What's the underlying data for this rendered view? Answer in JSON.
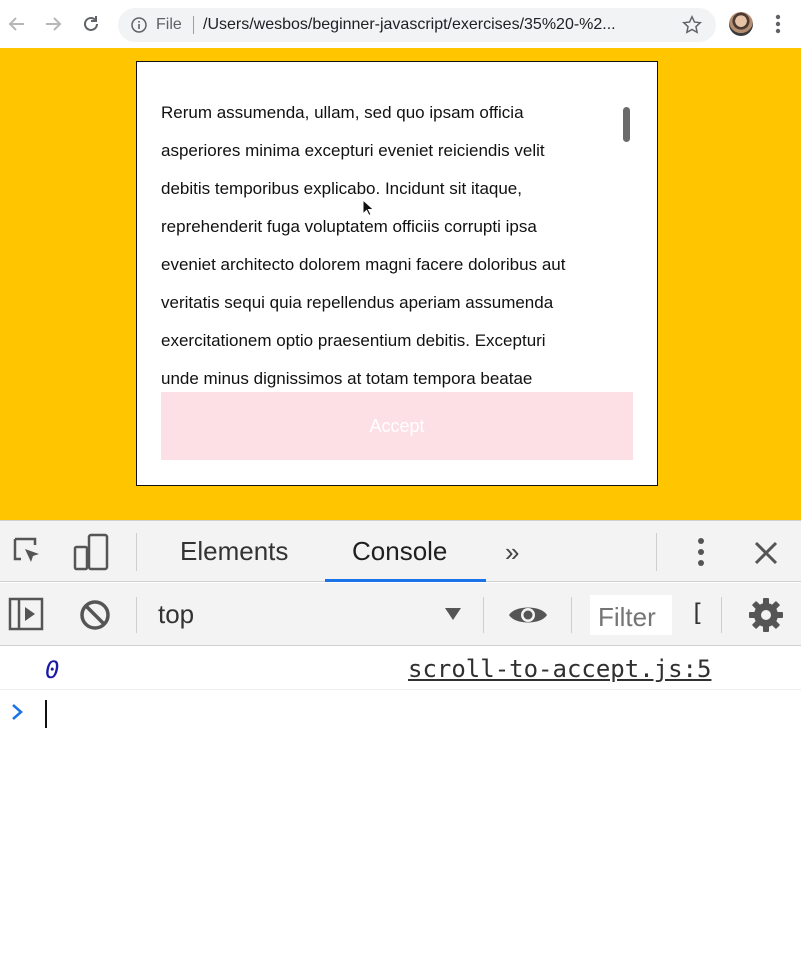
{
  "browser": {
    "omnibox": {
      "scheme_label": "File",
      "url": "/Users/wesbos/beginner-javascript/exercises/35%20-%2..."
    }
  },
  "page": {
    "terms_lines": [
      "Rerum assumenda, ullam, sed quo ipsam officia",
      "asperiores minima excepturi eveniet reiciendis velit",
      "debitis temporibus explicabo. Incidunt sit itaque,",
      "reprehenderit fuga voluptatem officiis corrupti ipsa",
      "eveniet architecto dolorem magni facere doloribus aut",
      "veritatis sequi quia repellendus aperiam assumenda",
      "exercitationem optio praesentium debitis. Excepturi",
      "unde minus dignissimos at totam tempora beatae"
    ],
    "accept_label": "Accept",
    "colors": {
      "background": "#ffc600",
      "accept_disabled": "#fde0e6"
    }
  },
  "devtools": {
    "tabs": [
      {
        "label": "Elements",
        "active": false
      },
      {
        "label": "Console",
        "active": true
      }
    ],
    "more_tabs": "»",
    "context": "top",
    "filter_placeholder": "Filter",
    "filter_overflow": "[",
    "log": {
      "value": "0",
      "source": "scroll-to-accept.js:5"
    },
    "prompt_symbol": ">",
    "accent_color": "#1a73e8"
  }
}
